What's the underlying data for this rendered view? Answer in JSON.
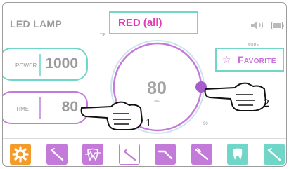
{
  "app_title": "LED LAMP",
  "preset": "RED (all)",
  "tip_label": "TIP",
  "mode_label": "MODE",
  "power": {
    "label": "POWER",
    "value": "1000"
  },
  "time": {
    "label": "TIME",
    "value": "80"
  },
  "mode_button": {
    "label": "Favorite",
    "icon": "star-icon"
  },
  "dial": {
    "value": "80",
    "unit": "sec",
    "max": "90",
    "fraction": 0.889
  },
  "callouts": [
    "1",
    "2"
  ],
  "tips": [
    {
      "name": "settings",
      "icon": "gear-icon",
      "style": "orange"
    },
    {
      "name": "tip-1",
      "icon": "straight-tip-icon",
      "style": "purple"
    },
    {
      "name": "tip-2",
      "icon": "tooth-pulse-icon",
      "style": "purple"
    },
    {
      "name": "tip-3",
      "icon": "pen-tip-icon",
      "style": "outline"
    },
    {
      "name": "tip-4",
      "icon": "angled-tip-icon",
      "style": "purple"
    },
    {
      "name": "tip-5",
      "icon": "double-tip-icon",
      "style": "purple"
    },
    {
      "name": "tip-6",
      "icon": "tooth-icon",
      "style": "teal"
    },
    {
      "name": "tip-7",
      "icon": "straight-tip-icon",
      "style": "teal"
    }
  ],
  "colors": {
    "teal": "#6fd6c8",
    "purple": "#c37ad8",
    "magenta_text": "#e13bb7",
    "orange": "#f39c2b",
    "gray_text": "#9b9b9b"
  }
}
